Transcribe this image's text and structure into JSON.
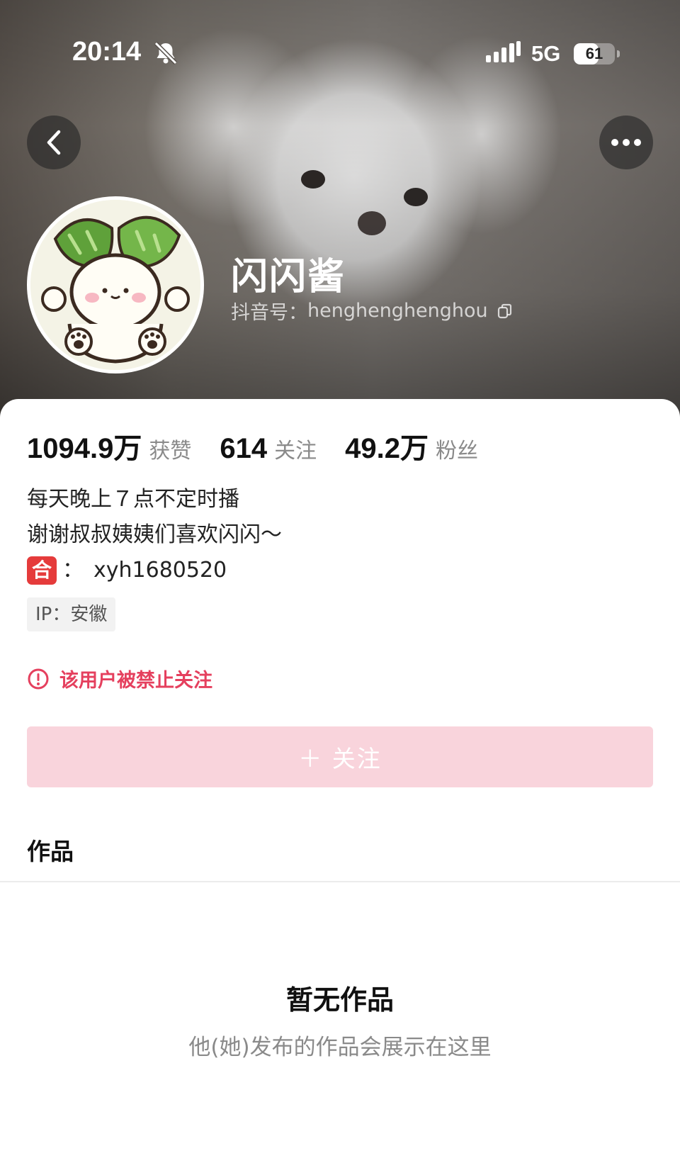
{
  "status_bar": {
    "time": "20:14",
    "network": "5G",
    "battery": "61",
    "battery_level": 0.61,
    "icons": [
      "bell-muted-icon",
      "signal-icon"
    ]
  },
  "profile": {
    "nickname": "闪闪酱",
    "account_label": "抖音号：",
    "account_id": "henghenghenghou"
  },
  "stats": {
    "likes_value": "1094.9万",
    "likes_label": "获赞",
    "following_value": "614",
    "following_label": "关注",
    "followers_value": "49.2万",
    "followers_label": "粉丝"
  },
  "bio": {
    "line1": "每天晚上７点不定时播",
    "line2": "谢谢叔叔姨姨们喜欢闪闪～",
    "contact_badge": "合",
    "contact_sep": "：",
    "contact_value": "xyh1680520"
  },
  "ip_tag": "IP：安徽",
  "ban_notice": "该用户被禁止关注",
  "follow_button": "＋ 关注",
  "tabs": {
    "works": "作品"
  },
  "empty_state": {
    "title": "暂无作品",
    "subtitle": "他(她)发布的作品会展示在这里"
  },
  "colors": {
    "accent_red": "#e5405e",
    "follow_btn_bg": "#f9d4dc",
    "badge_red": "#e53b3b"
  }
}
